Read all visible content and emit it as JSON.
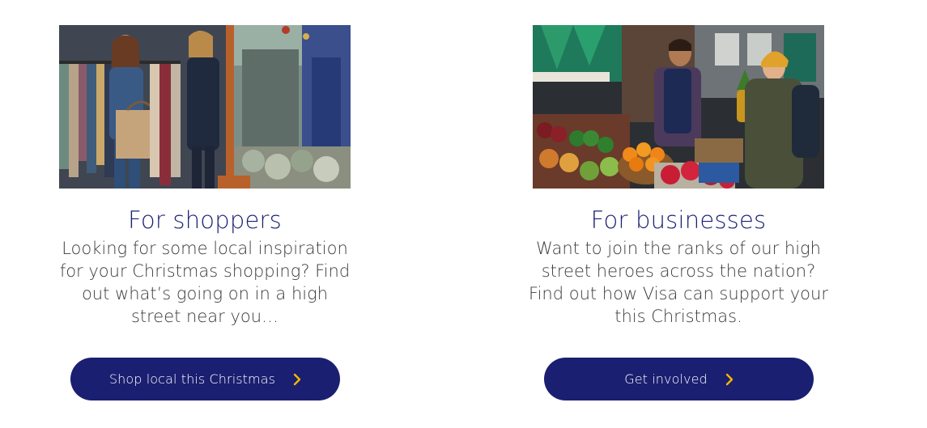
{
  "shoppers": {
    "image_name": "shoppers-photo",
    "title": "For shoppers",
    "body": "Looking for some local inspiration for your Christmas shopping? Find out what’s going on in a high street near you…",
    "cta_label": "Shop local this Christmas",
    "cta_icon": "chevron-right-icon"
  },
  "businesses": {
    "image_name": "businesses-photo",
    "title": "For businesses",
    "body": "Want to join the ranks of our high street heroes across the nation? Find out how Visa can support your this Christmas.",
    "cta_label": "Get involved",
    "cta_icon": "chevron-right-icon"
  },
  "colors": {
    "brand_blue": "#1a1f71",
    "accent_gold": "#f7b600",
    "body_text": "#3c3c3c"
  }
}
